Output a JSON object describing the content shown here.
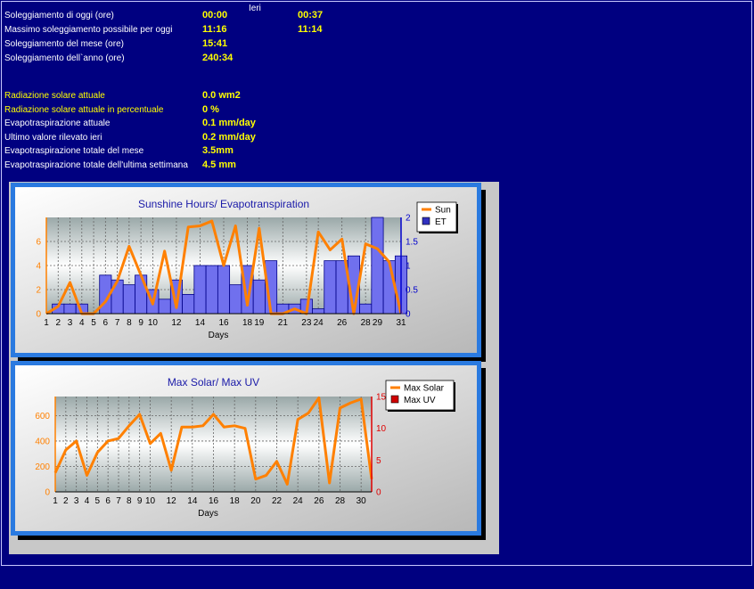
{
  "stats_header": "Ieri",
  "sun_rows": [
    {
      "label": "Soleggiamento di oggi (ore)",
      "today": "00:00",
      "yesterday": "00:37"
    },
    {
      "label": "Massimo soleggiamento possibile per oggi",
      "today": "11:16",
      "yesterday": "11:14"
    },
    {
      "label": "Soleggiamento del mese (ore)",
      "today": "15:41",
      "yesterday": ""
    },
    {
      "label": "Soleggiamento dell`anno (ore)",
      "today": "240:34",
      "yesterday": ""
    }
  ],
  "rad_rows": [
    {
      "label": "Radiazione solare attuale",
      "value": "0.0 wm2"
    },
    {
      "label": "Radiazione solare attuale in percentuale",
      "value": "0 %"
    },
    {
      "label": "Evapotraspirazione attuale",
      "value": "0.1 mm/day"
    },
    {
      "label": "Ultimo valore rilevato ieri",
      "value": "0.2 mm/day"
    },
    {
      "label": "Evapotraspirazione totale del mese",
      "value": "3.5mm"
    },
    {
      "label": "Evapotraspirazione totale dell'ultima settimana",
      "value": "4.5 mm"
    }
  ],
  "colors": {
    "background": "#000080",
    "label": "#ffffff",
    "value": "#ffff00",
    "line": "#ff8000",
    "bar": "#7070ee",
    "uv": "#e00000"
  },
  "chart_data": [
    {
      "type": "bar",
      "title": "Sunshine Hours/ Evapotranspiration",
      "xlabel": "Days",
      "x_ticks": [
        "1",
        "2",
        "3",
        "4",
        "5",
        "6",
        "7",
        "8",
        "9",
        "10",
        "12",
        "14",
        "16",
        "18",
        "19",
        "21",
        "23",
        "24",
        "26",
        "28",
        "29",
        "31"
      ],
      "x_tick_days": [
        1,
        2,
        3,
        4,
        5,
        6,
        7,
        8,
        9,
        10,
        12,
        14,
        16,
        18,
        19,
        21,
        23,
        24,
        26,
        28,
        29,
        31
      ],
      "ylim_left": [
        0,
        8
      ],
      "yticks_left": [
        0,
        2,
        4,
        6
      ],
      "ylim_right": [
        0,
        2
      ],
      "yticks_right": [
        0,
        0.5,
        1,
        1.5,
        2
      ],
      "legend": [
        "Sun",
        "ET"
      ],
      "legend_position": "top-right",
      "grid": true,
      "series": [
        {
          "name": "Sun",
          "axis": "left",
          "x": [
            1,
            2,
            3,
            4,
            5,
            6,
            7,
            8,
            9,
            10,
            11,
            12,
            13,
            14,
            15,
            16,
            17,
            18,
            19,
            20,
            21,
            22,
            23,
            24,
            25,
            26,
            27,
            28,
            29,
            30,
            31
          ],
          "values": [
            0,
            0.6,
            2.6,
            0,
            0,
            1,
            2.7,
            5.6,
            3.2,
            0.8,
            5.2,
            0.5,
            7.2,
            7.3,
            7.7,
            4,
            7.3,
            0.7,
            7.1,
            0,
            0,
            0.4,
            0,
            6.8,
            5.3,
            6.2,
            0,
            5.8,
            5.4,
            4.3,
            0
          ]
        },
        {
          "name": "ET",
          "axis": "right",
          "x": [
            1,
            2,
            3,
            4,
            5,
            6,
            7,
            8,
            9,
            10,
            11,
            12,
            13,
            14,
            15,
            16,
            17,
            18,
            19,
            20,
            21,
            22,
            23,
            24,
            25,
            26,
            27,
            28,
            29,
            30,
            31
          ],
          "values": [
            0,
            0.2,
            0.2,
            0.2,
            0,
            0.8,
            0.7,
            0.6,
            0.8,
            0.5,
            0.3,
            0.7,
            0.4,
            1,
            1,
            1,
            0.6,
            1,
            0.7,
            1.1,
            0.2,
            0.2,
            0.3,
            0.1,
            1.1,
            1.1,
            1.2,
            0.2,
            2,
            1.1,
            1.2
          ]
        }
      ]
    },
    {
      "type": "line",
      "title": "Max Solar/ Max UV",
      "xlabel": "Days",
      "x_ticks": [
        "1",
        "2",
        "3",
        "4",
        "5",
        "6",
        "7",
        "8",
        "9",
        "10",
        "12",
        "14",
        "16",
        "18",
        "20",
        "22",
        "24",
        "26",
        "28",
        "30"
      ],
      "x_tick_days": [
        1,
        2,
        3,
        4,
        5,
        6,
        7,
        8,
        9,
        10,
        12,
        14,
        16,
        18,
        20,
        22,
        24,
        26,
        28,
        30
      ],
      "ylim_left": [
        0,
        750
      ],
      "yticks_left": [
        0,
        200,
        400,
        600
      ],
      "ylim_right": [
        0,
        15
      ],
      "yticks_right": [
        0,
        5,
        10,
        15
      ],
      "legend": [
        "Max Solar",
        "Max UV"
      ],
      "legend_position": "top-right",
      "grid": true,
      "series": [
        {
          "name": "Max Solar",
          "axis": "left",
          "x": [
            1,
            2,
            3,
            4,
            5,
            6,
            7,
            8,
            9,
            10,
            11,
            12,
            13,
            14,
            15,
            16,
            17,
            18,
            19,
            20,
            21,
            22,
            23,
            24,
            25,
            26,
            27,
            28,
            29,
            30,
            31
          ],
          "values": [
            150,
            330,
            400,
            130,
            310,
            400,
            420,
            520,
            610,
            380,
            460,
            170,
            510,
            510,
            520,
            610,
            510,
            520,
            500,
            100,
            130,
            240,
            60,
            570,
            620,
            740,
            70,
            660,
            700,
            730,
            100
          ]
        },
        {
          "name": "Max UV",
          "axis": "right",
          "x": [],
          "values": []
        }
      ]
    }
  ]
}
